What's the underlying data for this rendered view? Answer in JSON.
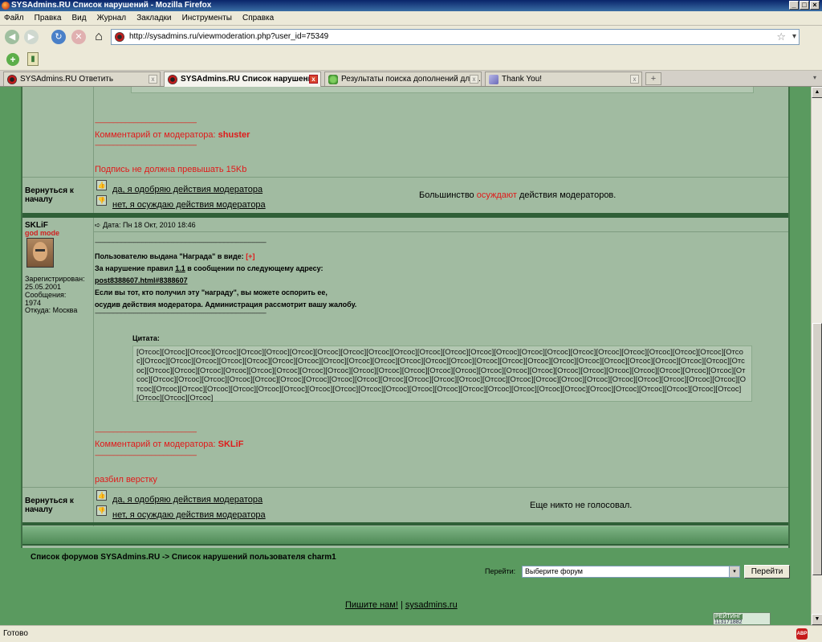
{
  "window": {
    "title": "SYSAdmins.RU Список нарушений - Mozilla Firefox",
    "min": "_",
    "max": "□",
    "close": "×"
  },
  "menu": [
    "Файл",
    "Правка",
    "Вид",
    "Журнал",
    "Закладки",
    "Инструменты",
    "Справка"
  ],
  "url": "http://sysadmins.ru/viewmoderation.php?user_id=75349",
  "tabs": [
    {
      "label": "SYSAdmins.RU Ответить",
      "active": false
    },
    {
      "label": "SYSAdmins.RU Список нарушений",
      "active": true
    },
    {
      "label": "Результаты поиска дополнений для ...",
      "active": false
    },
    {
      "label": "Thank You!",
      "active": false
    }
  ],
  "block1": {
    "comment_prefix": "Комментарий от модератора: ",
    "moderator": "shuster",
    "reason": "Подпись не должна превышать 15Kb",
    "back": "Вернуться к началу",
    "approve": "да, я одобряю действия модератора",
    "condemn": "нет, я осуждаю действия модератора",
    "result_prefix": "Большинство ",
    "result_word": "осуждают",
    "result_suffix": " действия модераторов."
  },
  "post": {
    "username": "SKLiF",
    "rank": "god mode",
    "registered_label": "Зарегистрирован:",
    "registered": "25.05.2001",
    "posts_label": "Сообщения:",
    "posts": "1974",
    "from_label": "Откуда:",
    "from": "Москва",
    "date": "Дата: Пн 18 Окт, 2010 18:46",
    "line1": "Пользователю выдана \"Награда\" в виде: ",
    "award": "[+]",
    "line2_prefix": "За нарушение правил ",
    "rule": "1.1",
    "line2_suffix": " в сообщении по следующему адресу:",
    "link": "post8388607.html#8388607",
    "line3": "Если вы тот, кто получил эту \"награду\", вы можете оспорить ее,",
    "line4": "осудив действия модератора. Администрация рассмотрит вашу жалобу.",
    "quote_label": "Цитата:",
    "quote": "[Отсос][Отсос][Отсос][Отсос][Отсос][Отсос][Отсос][Отсос][Отсос][Отсос][Отсос][Отсос][Отсос][Отсос][Отсос][Отсос][Отсос][Отсос][Отсос][Отсос][Отсос][Отсос][Отсос][Отсос][Отсос][Отсос][Отсос][Отсос][Отсос][Отсос][Отсос][Отсос][Отсос][Отсос][Отсос][Отсос][Отсос][Отсос][Отсос][Отсос][Отсос][Отсос][Отсос][Отсос][Отсос][Отсос][Отсос][Отсос][Отсос][Отсос][Отсос][Отсос][Отсос][Отсос][Отсос][Отсос][Отсос][Отсос][Отсос][Отсос][Отсос][Отсос][Отсос][Отсос][Отсос][Отсос][Отсос][Отсос][Отсос][Отсос][Отсос][Отсос][Отсос][Отсос][Отсос][Отсос][Отсос][Отсос][Отсос][Отсос][Отсос][Отсос][Отсос][Отсос][Отсос][Отсос][Отсос][Отсос][Отсос][Отсос][Отсос][Отсос][Отсос][Отсос][Отсос][Отсос][Отсос][Отсос][Отсос][Отсос][Отсос][Отсос][Отсос][Отсос][Отсос][Отсос][Отсос][Отсос][Отсос][Отсос][Отсос][Отсос][Отсос][Отсос][Отсос][Отсос][Отсос][Отсос][Отсос][Отсос][Отсос][Отсос]",
    "comment_prefix": "Комментарий от модератора: ",
    "moderator": "SKLiF",
    "reason": "разбил верстку"
  },
  "block2": {
    "back": "Вернуться к началу",
    "approve": "да, я одобряю действия модератора",
    "condemn": "нет, я осуждаю действия модератора",
    "result": "Еще никто не голосовал."
  },
  "breadcrumb": "Список форумов SYSAdmins.RU -> Список нарушений пользователя charm1",
  "jump": {
    "label": "Перейти:",
    "selected": "Выберите форум",
    "button": "Перейти"
  },
  "footer": {
    "write": "Пишите нам!",
    "sep": " | ",
    "site": "sysadmins.ru"
  },
  "counter": {
    "label": "РЕЙТИНГ",
    "a": "113171882",
    "b": "29228"
  },
  "status": "Готово",
  "icons": {
    "back": "◀",
    "forward": "▶",
    "reload": "↻",
    "stop": "✕",
    "home": "⌂",
    "star": "☆",
    "dropdown": "▾",
    "bookmark_add": "+",
    "bookmark": "▮",
    "tab_close": "x",
    "new_tab": "+",
    "scroll_up": "▲",
    "scroll_down": "▼",
    "approve": "👍",
    "condemn": "👎",
    "post_marker": "➪",
    "adblock": "ABP"
  },
  "colors": {
    "forum_bg": "#a1bba1",
    "page_bg": "#5a9a5f",
    "moderator_red": "#e01a1a",
    "rank_red": "#d02020"
  }
}
